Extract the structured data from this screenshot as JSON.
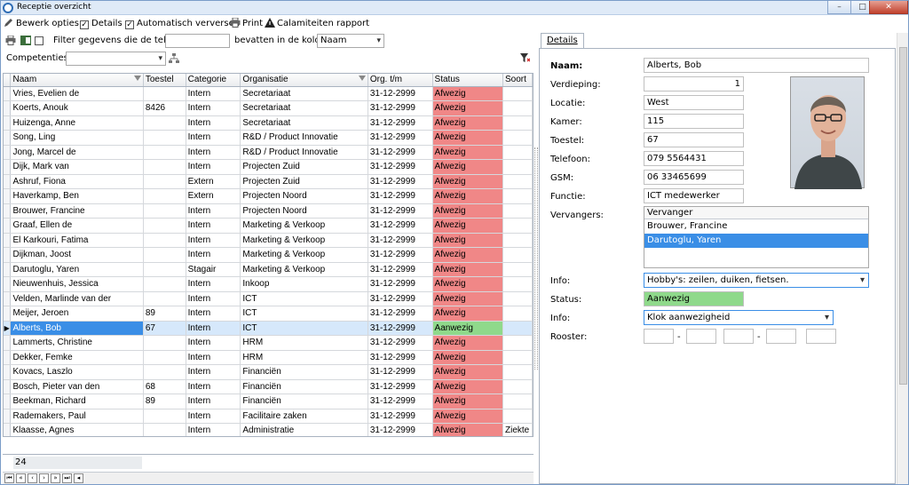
{
  "window": {
    "title": "Receptie overzicht"
  },
  "toolbar": {
    "bewerk_label": "Bewerk opties",
    "details_label": "Details",
    "refresh_label": "Automatisch verversen",
    "print_label": "Print",
    "calamity_label": "Calamiteiten rapport"
  },
  "filter": {
    "label": "Filter gegevens die de tekst:",
    "text_value": "",
    "column_label": "bevatten in de kolom",
    "column_value": "Naam"
  },
  "competencies": {
    "label": "Competenties:",
    "value": ""
  },
  "grid": {
    "columns": [
      "Naam",
      "Toestel",
      "Categorie",
      "Organisatie",
      "Org. t/m",
      "Status",
      "Soort"
    ],
    "rows": [
      {
        "naam": "Vries, Evelien de",
        "toestel": "",
        "cat": "Intern",
        "org": "Secretariaat",
        "tm": "31-12-2999",
        "status": "Afwezig",
        "soort": ""
      },
      {
        "naam": "Koerts, Anouk",
        "toestel": "8426",
        "cat": "Intern",
        "org": "Secretariaat",
        "tm": "31-12-2999",
        "status": "Afwezig",
        "soort": ""
      },
      {
        "naam": "Huizenga, Anne",
        "toestel": "",
        "cat": "Intern",
        "org": "Secretariaat",
        "tm": "31-12-2999",
        "status": "Afwezig",
        "soort": ""
      },
      {
        "naam": "Song, Ling",
        "toestel": "",
        "cat": "Intern",
        "org": "R&D / Product Innovatie",
        "tm": "31-12-2999",
        "status": "Afwezig",
        "soort": ""
      },
      {
        "naam": "Jong, Marcel de",
        "toestel": "",
        "cat": "Intern",
        "org": "R&D / Product Innovatie",
        "tm": "31-12-2999",
        "status": "Afwezig",
        "soort": ""
      },
      {
        "naam": "Dijk, Mark van",
        "toestel": "",
        "cat": "Intern",
        "org": "Projecten Zuid",
        "tm": "31-12-2999",
        "status": "Afwezig",
        "soort": ""
      },
      {
        "naam": "Ashruf, Fiona",
        "toestel": "",
        "cat": "Extern",
        "org": "Projecten Zuid",
        "tm": "31-12-2999",
        "status": "Afwezig",
        "soort": ""
      },
      {
        "naam": "Haverkamp, Ben",
        "toestel": "",
        "cat": "Extern",
        "org": "Projecten Noord",
        "tm": "31-12-2999",
        "status": "Afwezig",
        "soort": ""
      },
      {
        "naam": "Brouwer, Francine",
        "toestel": "",
        "cat": "Intern",
        "org": "Projecten Noord",
        "tm": "31-12-2999",
        "status": "Afwezig",
        "soort": ""
      },
      {
        "naam": "Graaf, Ellen de",
        "toestel": "",
        "cat": "Intern",
        "org": "Marketing & Verkoop",
        "tm": "31-12-2999",
        "status": "Afwezig",
        "soort": ""
      },
      {
        "naam": "El Karkouri, Fatima",
        "toestel": "",
        "cat": "Intern",
        "org": "Marketing & Verkoop",
        "tm": "31-12-2999",
        "status": "Afwezig",
        "soort": ""
      },
      {
        "naam": "Dijkman, Joost",
        "toestel": "",
        "cat": "Intern",
        "org": "Marketing & Verkoop",
        "tm": "31-12-2999",
        "status": "Afwezig",
        "soort": ""
      },
      {
        "naam": "Darutoglu, Yaren",
        "toestel": "",
        "cat": "Stagair",
        "org": "Marketing & Verkoop",
        "tm": "31-12-2999",
        "status": "Afwezig",
        "soort": ""
      },
      {
        "naam": "Nieuwenhuis, Jessica",
        "toestel": "",
        "cat": "Intern",
        "org": "Inkoop",
        "tm": "31-12-2999",
        "status": "Afwezig",
        "soort": ""
      },
      {
        "naam": "Velden, Marlinde van der",
        "toestel": "",
        "cat": "Intern",
        "org": "ICT",
        "tm": "31-12-2999",
        "status": "Afwezig",
        "soort": ""
      },
      {
        "naam": "Meijer, Jeroen",
        "toestel": "89",
        "cat": "Intern",
        "org": "ICT",
        "tm": "31-12-2999",
        "status": "Afwezig",
        "soort": ""
      },
      {
        "naam": "Alberts, Bob",
        "toestel": "67",
        "cat": "Intern",
        "org": "ICT",
        "tm": "31-12-2999",
        "status": "Aanwezig",
        "soort": "",
        "selected": true
      },
      {
        "naam": "Lammerts, Christine",
        "toestel": "",
        "cat": "Intern",
        "org": "HRM",
        "tm": "31-12-2999",
        "status": "Afwezig",
        "soort": ""
      },
      {
        "naam": "Dekker, Femke",
        "toestel": "",
        "cat": "Intern",
        "org": "HRM",
        "tm": "31-12-2999",
        "status": "Afwezig",
        "soort": ""
      },
      {
        "naam": "Kovacs, Laszlo",
        "toestel": "",
        "cat": "Intern",
        "org": "Financiën",
        "tm": "31-12-2999",
        "status": "Afwezig",
        "soort": ""
      },
      {
        "naam": "Bosch, Pieter van den",
        "toestel": "68",
        "cat": "Intern",
        "org": "Financiën",
        "tm": "31-12-2999",
        "status": "Afwezig",
        "soort": ""
      },
      {
        "naam": "Beekman, Richard",
        "toestel": "89",
        "cat": "Intern",
        "org": "Financiën",
        "tm": "31-12-2999",
        "status": "Afwezig",
        "soort": ""
      },
      {
        "naam": "Rademakers, Paul",
        "toestel": "",
        "cat": "Intern",
        "org": "Facilitaire zaken",
        "tm": "31-12-2999",
        "status": "Afwezig",
        "soort": ""
      },
      {
        "naam": "Klaasse, Agnes",
        "toestel": "",
        "cat": "Intern",
        "org": "Administratie",
        "tm": "31-12-2999",
        "status": "Afwezig",
        "soort": "Ziekte"
      }
    ],
    "count": "24"
  },
  "details": {
    "tab_label": "Details",
    "naam_label": "Naam:",
    "naam": "Alberts, Bob",
    "verdieping_label": "Verdieping:",
    "verdieping": "1",
    "locatie_label": "Locatie:",
    "locatie": "West",
    "kamer_label": "Kamer:",
    "kamer": "115",
    "toestel_label": "Toestel:",
    "toestel": "67",
    "telefoon_label": "Telefoon:",
    "telefoon": "079 5564431",
    "gsm_label": "GSM:",
    "gsm": "06 33465699",
    "functie_label": "Functie:",
    "functie": "ICT medewerker",
    "vervangers_label": "Vervangers:",
    "vervangers_header": "Vervanger",
    "vervangers": [
      "Brouwer, Francine",
      "Darutoglu, Yaren"
    ],
    "info_label": "Info:",
    "info_value": "Hobby's: zeilen, duiken, fietsen.",
    "status_label": "Status:",
    "status_value": "Aanwezig",
    "info2_label": "Info:",
    "info2_value": "Klok aanwezigheid",
    "rooster_label": "Rooster:",
    "rooster_sep": "-"
  },
  "colors": {
    "absent": "#f08787",
    "present": "#8fd98b",
    "selection": "#3a8ee6"
  }
}
